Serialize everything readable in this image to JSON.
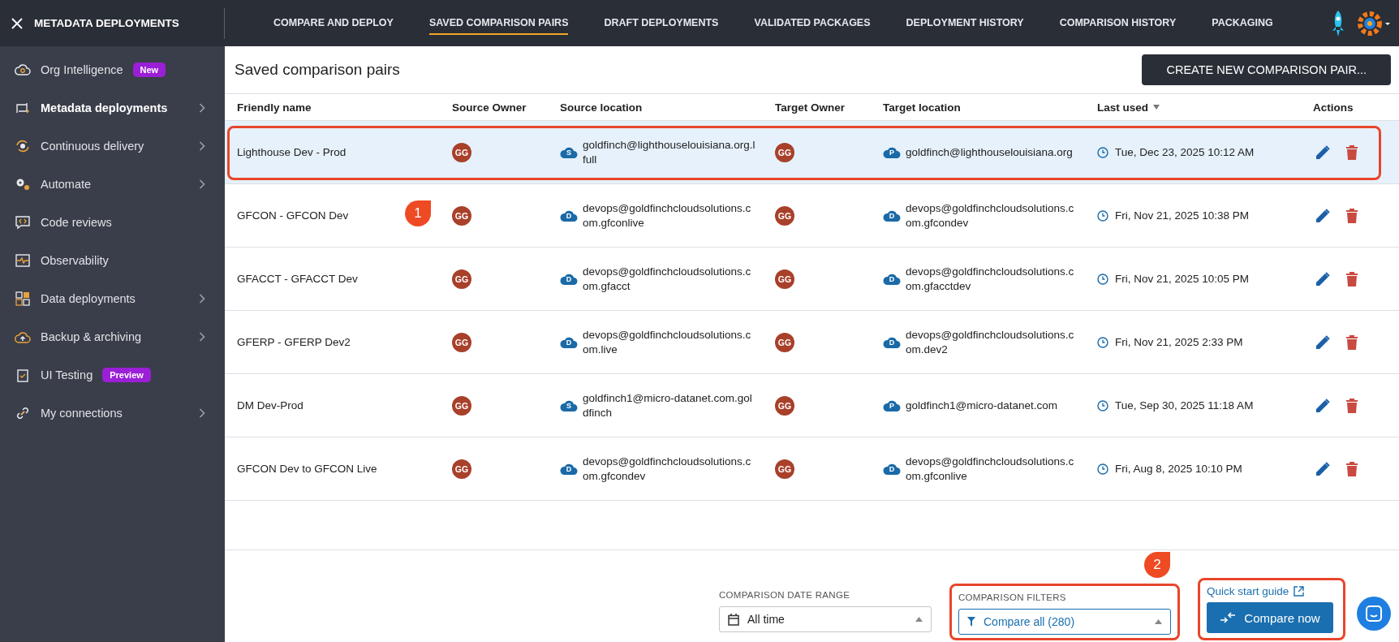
{
  "app_title": "METADATA DEPLOYMENTS",
  "nav_tabs": [
    {
      "label": "COMPARE AND DEPLOY",
      "selected": false
    },
    {
      "label": "SAVED COMPARISON PAIRS",
      "selected": true
    },
    {
      "label": "DRAFT DEPLOYMENTS",
      "selected": false
    },
    {
      "label": "VALIDATED PACKAGES",
      "selected": false
    },
    {
      "label": "DEPLOYMENT HISTORY",
      "selected": false
    },
    {
      "label": "COMPARISON HISTORY",
      "selected": false
    },
    {
      "label": "PACKAGING",
      "selected": false
    }
  ],
  "sidebar": {
    "items": [
      {
        "kind": "cloud-search",
        "label": "Org Intelligence",
        "badge": "New",
        "expandable": false,
        "selected": false
      },
      {
        "kind": "swap",
        "label": "Metadata deployments",
        "expandable": true,
        "selected": true
      },
      {
        "kind": "cycle",
        "label": "Continuous delivery",
        "expandable": true,
        "selected": false
      },
      {
        "kind": "gears",
        "label": "Automate",
        "expandable": true,
        "selected": false
      },
      {
        "kind": "code",
        "label": "Code reviews",
        "expandable": false,
        "selected": false
      },
      {
        "kind": "pulse",
        "label": "Observability",
        "expandable": false,
        "selected": false
      },
      {
        "kind": "grid",
        "label": "Data deployments",
        "expandable": true,
        "selected": false
      },
      {
        "kind": "cloud-up",
        "label": "Backup & archiving",
        "expandable": true,
        "selected": false
      },
      {
        "kind": "clipboard",
        "label": "UI Testing",
        "badge": "Preview",
        "expandable": false,
        "selected": false
      },
      {
        "kind": "link",
        "label": "My connections",
        "expandable": true,
        "selected": false
      }
    ]
  },
  "page_title": "Saved comparison pairs",
  "create_button": "CREATE NEW COMPARISON PAIR...",
  "table": {
    "columns": [
      {
        "label": "Friendly name",
        "sorted": false
      },
      {
        "label": "Source Owner",
        "sorted": false
      },
      {
        "label": "Source location",
        "sorted": false
      },
      {
        "label": "Target Owner",
        "sorted": false
      },
      {
        "label": "Target location",
        "sorted": false
      },
      {
        "label": "Last used",
        "sorted": true
      },
      {
        "label": "Actions",
        "sorted": false
      }
    ],
    "rows": [
      {
        "name": "Lighthouse Dev - Prod",
        "source_owner": "GG",
        "source_type": "S",
        "source_location": "goldfinch@lighthouselouisiana.org.lfull",
        "target_owner": "GG",
        "target_type": "P",
        "target_location": "goldfinch@lighthouselouisiana.org",
        "last_used": "Tue, Dec 23, 2025 10:12 AM",
        "selected": true,
        "highlighted": true,
        "marker": "1"
      },
      {
        "name": "GFCON - GFCON Dev",
        "source_owner": "GG",
        "source_type": "D",
        "source_location": "devops@goldfinchcloudsolutions.com.gfconlive",
        "target_owner": "GG",
        "target_type": "D",
        "target_location": "devops@goldfinchcloudsolutions.com.gfcondev",
        "last_used": "Fri, Nov 21, 2025 10:38 PM",
        "selected": false,
        "highlighted": false
      },
      {
        "name": "GFACCT - GFACCT Dev",
        "source_owner": "GG",
        "source_type": "D",
        "source_location": "devops@goldfinchcloudsolutions.com.gfacct",
        "target_owner": "GG",
        "target_type": "D",
        "target_location": "devops@goldfinchcloudsolutions.com.gfacctdev",
        "last_used": "Fri, Nov 21, 2025 10:05 PM",
        "selected": false,
        "highlighted": false
      },
      {
        "name": "GFERP - GFERP Dev2",
        "source_owner": "GG",
        "source_type": "D",
        "source_location": "devops@goldfinchcloudsolutions.com.live",
        "target_owner": "GG",
        "target_type": "D",
        "target_location": "devops@goldfinchcloudsolutions.com.dev2",
        "last_used": "Fri, Nov 21, 2025 2:33 PM",
        "selected": false,
        "highlighted": false
      },
      {
        "name": "DM Dev-Prod",
        "source_owner": "GG",
        "source_type": "S",
        "source_location": "goldfinch1@micro-datanet.com.goldfinch",
        "target_owner": "GG",
        "target_type": "P",
        "target_location": "goldfinch1@micro-datanet.com",
        "last_used": "Tue, Sep 30, 2025 11:18 AM",
        "selected": false,
        "highlighted": false
      },
      {
        "name": "GFCON Dev to GFCON Live",
        "source_owner": "GG",
        "source_type": "D",
        "source_location": "devops@goldfinchcloudsolutions.com.gfcondev",
        "target_owner": "GG",
        "target_type": "D",
        "target_location": "devops@goldfinchcloudsolutions.com.gfconlive",
        "last_used": "Fri, Aug 8, 2025 10:10 PM",
        "selected": false,
        "highlighted": false
      }
    ]
  },
  "footer": {
    "date_range": {
      "label": "COMPARISON DATE RANGE",
      "value": "All time"
    },
    "filters": {
      "label": "COMPARISON FILTERS",
      "value": "Compare all (280)",
      "highlighted": true
    },
    "quick_start": "Quick start guide",
    "compare_button": "Compare now",
    "compare_highlighted": true,
    "compare_marker": "2"
  }
}
